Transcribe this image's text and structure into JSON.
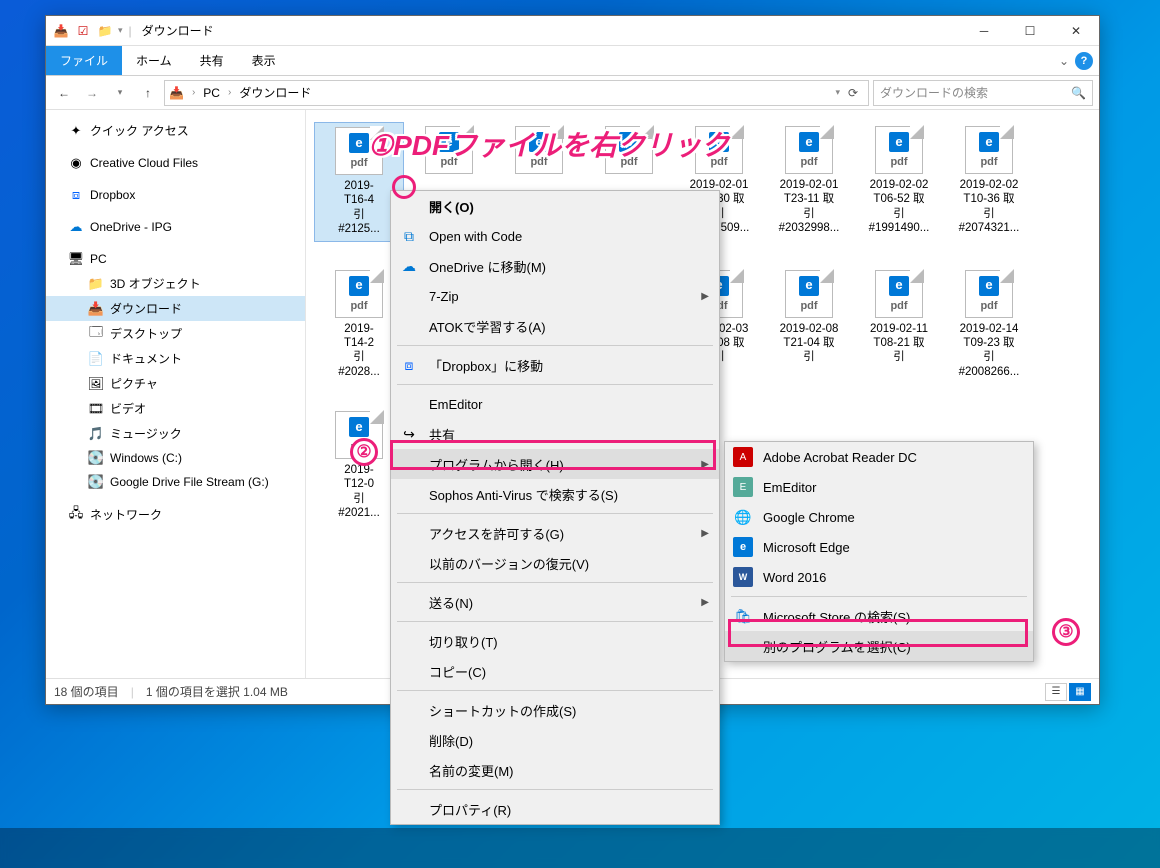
{
  "window": {
    "title": "ダウンロード"
  },
  "ribbon": {
    "file": "ファイル",
    "home": "ホーム",
    "share": "共有",
    "view": "表示"
  },
  "breadcrumb": {
    "pc": "PC",
    "folder": "ダウンロード"
  },
  "search": {
    "placeholder": "ダウンロードの検索"
  },
  "sidebar": {
    "quick": "クイック アクセス",
    "ccf": "Creative Cloud Files",
    "dropbox": "Dropbox",
    "onedrive": "OneDrive - IPG",
    "pc": "PC",
    "threeD": "3D オブジェクト",
    "downloads": "ダウンロード",
    "desktop": "デスクトップ",
    "documents": "ドキュメント",
    "pictures": "ピクチャ",
    "videos": "ビデオ",
    "music": "ミュージック",
    "cdrive": "Windows (C:)",
    "gdrive": "Google Drive File Stream (G:)",
    "network": "ネットワーク"
  },
  "files": {
    "row1": [
      {
        "l1": "2019-",
        "l2": "T16-4",
        "l3": "引",
        "l4": "#2125..."
      },
      {
        "l1": "",
        "l2": "",
        "l3": "",
        "l4": ""
      },
      {
        "l1": "",
        "l2": "",
        "l3": "",
        "l4": ""
      },
      {
        "l1": "",
        "l2": "",
        "l3": "",
        "l4": ""
      },
      {
        "l1": "2019-02-01",
        "l2": "T21-30 取",
        "l3": "引",
        "l4": "#1967509..."
      },
      {
        "l1": "2019-02-01",
        "l2": "T23-11 取",
        "l3": "引",
        "l4": "#2032998..."
      },
      {
        "l1": "2019-02-02",
        "l2": "T06-52 取",
        "l3": "引",
        "l4": "#1991490..."
      },
      {
        "l1": "2019-02-02",
        "l2": "T10-36 取",
        "l3": "引",
        "l4": "#2074321..."
      }
    ],
    "row2": [
      {
        "l1": "2019-",
        "l2": "T14-2",
        "l3": "引",
        "l4": "#2028..."
      },
      {
        "l1": "",
        "l2": "",
        "l3": "",
        "l4": ""
      },
      {
        "l1": "",
        "l2": "",
        "l3": "",
        "l4": ""
      },
      {
        "l1": "",
        "l2": "",
        "l3": "",
        "l4": ""
      },
      {
        "l1": "2019-02-03",
        "l2": "T23-08 取",
        "l3": "引",
        "l4": ""
      },
      {
        "l1": "2019-02-08",
        "l2": "T21-04 取",
        "l3": "引",
        "l4": ""
      },
      {
        "l1": "2019-02-11",
        "l2": "T08-21 取",
        "l3": "引",
        "l4": ""
      },
      {
        "l1": "2019-02-14",
        "l2": "T09-23 取",
        "l3": "引",
        "l4": "#2008266..."
      }
    ],
    "row3": [
      {
        "l1": "2019-",
        "l2": "T12-0",
        "l3": "引",
        "l4": "#2021..."
      }
    ]
  },
  "contextMenu": {
    "open": "開く(O)",
    "openCode": "Open with Code",
    "onedriveMove": "OneDrive に移動(M)",
    "sevenZip": "7-Zip",
    "atok": "ATOKで学習する(A)",
    "dropboxMove": "「Dropbox」に移動",
    "emeditor": "EmEditor",
    "share": "共有",
    "openWith": "プログラムから開く(H)",
    "sophos": "Sophos Anti-Virus で検索する(S)",
    "access": "アクセスを許可する(G)",
    "prevVersion": "以前のバージョンの復元(V)",
    "sendTo": "送る(N)",
    "cut": "切り取り(T)",
    "copy": "コピー(C)",
    "shortcut": "ショートカットの作成(S)",
    "delete": "削除(D)",
    "rename": "名前の変更(M)",
    "properties": "プロパティ(R)"
  },
  "subMenu": {
    "adobe": "Adobe Acrobat Reader DC",
    "emeditor": "EmEditor",
    "chrome": "Google Chrome",
    "edge": "Microsoft Edge",
    "word": "Word 2016",
    "store": "Microsoft Store の検索(S)",
    "choose": "別のプログラムを選択(C)"
  },
  "status": {
    "count": "18 個の項目",
    "selected": "1 個の項目を選択 1.04 MB"
  },
  "annotations": {
    "step1": "①PDFファイルを右クリック",
    "step2": "②",
    "step3": "③"
  }
}
